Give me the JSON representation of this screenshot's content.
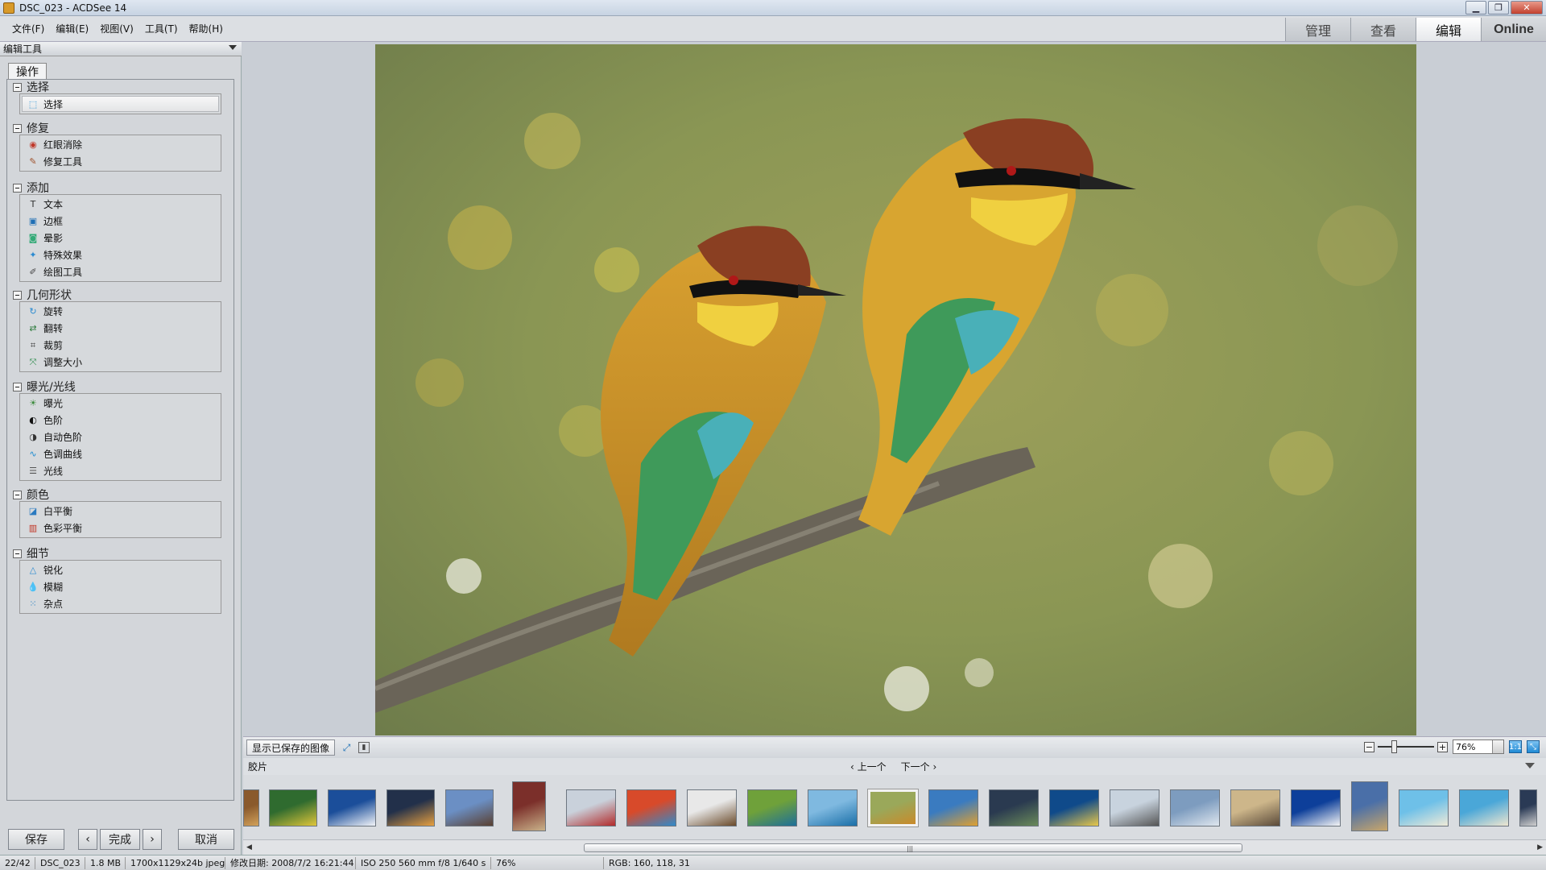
{
  "window": {
    "title": "DSC_023 - ACDSee 14",
    "minimize": "▁",
    "restore": "❐",
    "close": "✕"
  },
  "menu": [
    "文件(F)",
    "编辑(E)",
    "视图(V)",
    "工具(T)",
    "帮助(H)"
  ],
  "modes": {
    "manage": "管理",
    "view": "查看",
    "edit": "编辑",
    "online": "Online"
  },
  "panel": {
    "header": "编辑工具",
    "tab": "操作",
    "groups": [
      {
        "title": "选择",
        "tools": [
          {
            "label": "选择",
            "icon": "select-icon"
          }
        ]
      },
      {
        "title": "修复",
        "tools": [
          {
            "label": "红眼消除",
            "icon": "red-eye-icon"
          },
          {
            "label": "修复工具",
            "icon": "repair-icon"
          }
        ]
      },
      {
        "title": "添加",
        "tools": [
          {
            "label": "文本",
            "icon": "text-icon"
          },
          {
            "label": "边框",
            "icon": "border-icon"
          },
          {
            "label": "晕影",
            "icon": "vignette-icon"
          },
          {
            "label": "特殊效果",
            "icon": "effects-icon"
          },
          {
            "label": "绘图工具",
            "icon": "drawing-icon"
          }
        ]
      },
      {
        "title": "几何形状",
        "tools": [
          {
            "label": "旋转",
            "icon": "rotate-icon"
          },
          {
            "label": "翻转",
            "icon": "flip-icon"
          },
          {
            "label": "裁剪",
            "icon": "crop-icon"
          },
          {
            "label": "调整大小",
            "icon": "resize-icon"
          }
        ]
      },
      {
        "title": "曝光/光线",
        "tools": [
          {
            "label": "曝光",
            "icon": "exposure-icon"
          },
          {
            "label": "色阶",
            "icon": "levels-icon"
          },
          {
            "label": "自动色阶",
            "icon": "auto-levels-icon"
          },
          {
            "label": "色调曲线",
            "icon": "tone-curve-icon"
          },
          {
            "label": "光线",
            "icon": "lighting-icon"
          }
        ]
      },
      {
        "title": "颜色",
        "tools": [
          {
            "label": "白平衡",
            "icon": "white-balance-icon"
          },
          {
            "label": "色彩平衡",
            "icon": "color-balance-icon"
          }
        ]
      },
      {
        "title": "细节",
        "tools": [
          {
            "label": "锐化",
            "icon": "sharpen-icon"
          },
          {
            "label": "模糊",
            "icon": "blur-icon"
          },
          {
            "label": "杂点",
            "icon": "noise-icon"
          }
        ]
      }
    ],
    "buttons": {
      "save": "保存",
      "prev": "‹",
      "done": "完成",
      "next": "›",
      "cancel": "取消"
    }
  },
  "viewer": {
    "show_saved": "显示已保存的图像",
    "zoom_minus": "−",
    "zoom_plus": "+",
    "zoom_value": "76%",
    "zoom_level": 0.27
  },
  "filmstrip": {
    "label": "胶片",
    "prev": "‹ 上一个",
    "next": "下一个 ›",
    "thumbs": [
      {
        "name": "thumb-01",
        "c1": "#8a5a2c",
        "c2": "#d2a15a"
      },
      {
        "name": "thumb-02",
        "c1": "#2f6b2f",
        "c2": "#e0c63a"
      },
      {
        "name": "thumb-03",
        "c1": "#1b4e9a",
        "c2": "#f2f4f8"
      },
      {
        "name": "thumb-04",
        "c1": "#22304a",
        "c2": "#e7a040"
      },
      {
        "name": "thumb-05",
        "c1": "#6b8fc4",
        "c2": "#5a4030"
      },
      {
        "name": "thumb-06",
        "c1": "#7b2f2a",
        "c2": "#c9b28a"
      },
      {
        "name": "thumb-07",
        "c1": "#c9d1db",
        "c2": "#b22a2a"
      },
      {
        "name": "thumb-08",
        "c1": "#d84a2a",
        "c2": "#2f8acb"
      },
      {
        "name": "thumb-09",
        "c1": "#e8e8e8",
        "c2": "#6a4a2a"
      },
      {
        "name": "thumb-10",
        "c1": "#6fa13a",
        "c2": "#1d6f9a"
      },
      {
        "name": "thumb-11",
        "c1": "#7fb9e0",
        "c2": "#1a6fa8"
      },
      {
        "name": "thumb-12",
        "c1": "#9aa85a",
        "c2": "#c98a2a"
      },
      {
        "name": "thumb-13",
        "c1": "#3a7bc0",
        "c2": "#e0a030"
      },
      {
        "name": "thumb-14",
        "c1": "#2a3a50",
        "c2": "#6a8a5a"
      },
      {
        "name": "thumb-15",
        "c1": "#0f4a8a",
        "c2": "#e8c84a"
      },
      {
        "name": "thumb-16",
        "c1": "#c8d3de",
        "c2": "#555555"
      },
      {
        "name": "thumb-17",
        "c1": "#7d9cbf",
        "c2": "#dfe6ee"
      },
      {
        "name": "thumb-18",
        "c1": "#cdb68a",
        "c2": "#5a4a3a"
      },
      {
        "name": "thumb-19",
        "c1": "#0d3f9a",
        "c2": "#f5f5f5"
      },
      {
        "name": "thumb-20",
        "c1": "#4a6fa8",
        "c2": "#c9a66a"
      },
      {
        "name": "thumb-21",
        "c1": "#6ec0e8",
        "c2": "#f0ead8"
      },
      {
        "name": "thumb-22",
        "c1": "#4aa7d8",
        "c2": "#efe6d0"
      },
      {
        "name": "thumb-23",
        "c1": "#2a3a55",
        "c2": "#d0d0d0"
      }
    ]
  },
  "status": {
    "index": "22/42",
    "filename": "DSC_023",
    "filesize": "1.8 MB",
    "dimensions": "1700x1129x24b jpeg",
    "modified": "修改日期: 2008/7/2 16:21:44",
    "exif": "ISO 250   560 mm   f/8   1/640 s",
    "zoom": "76%",
    "rgb": "RGB: 160, 118, 31"
  },
  "colors": {
    "accent": "#1f8ad4",
    "panel_bg": "#d3d6da",
    "main_bg": "#c9ced5"
  }
}
